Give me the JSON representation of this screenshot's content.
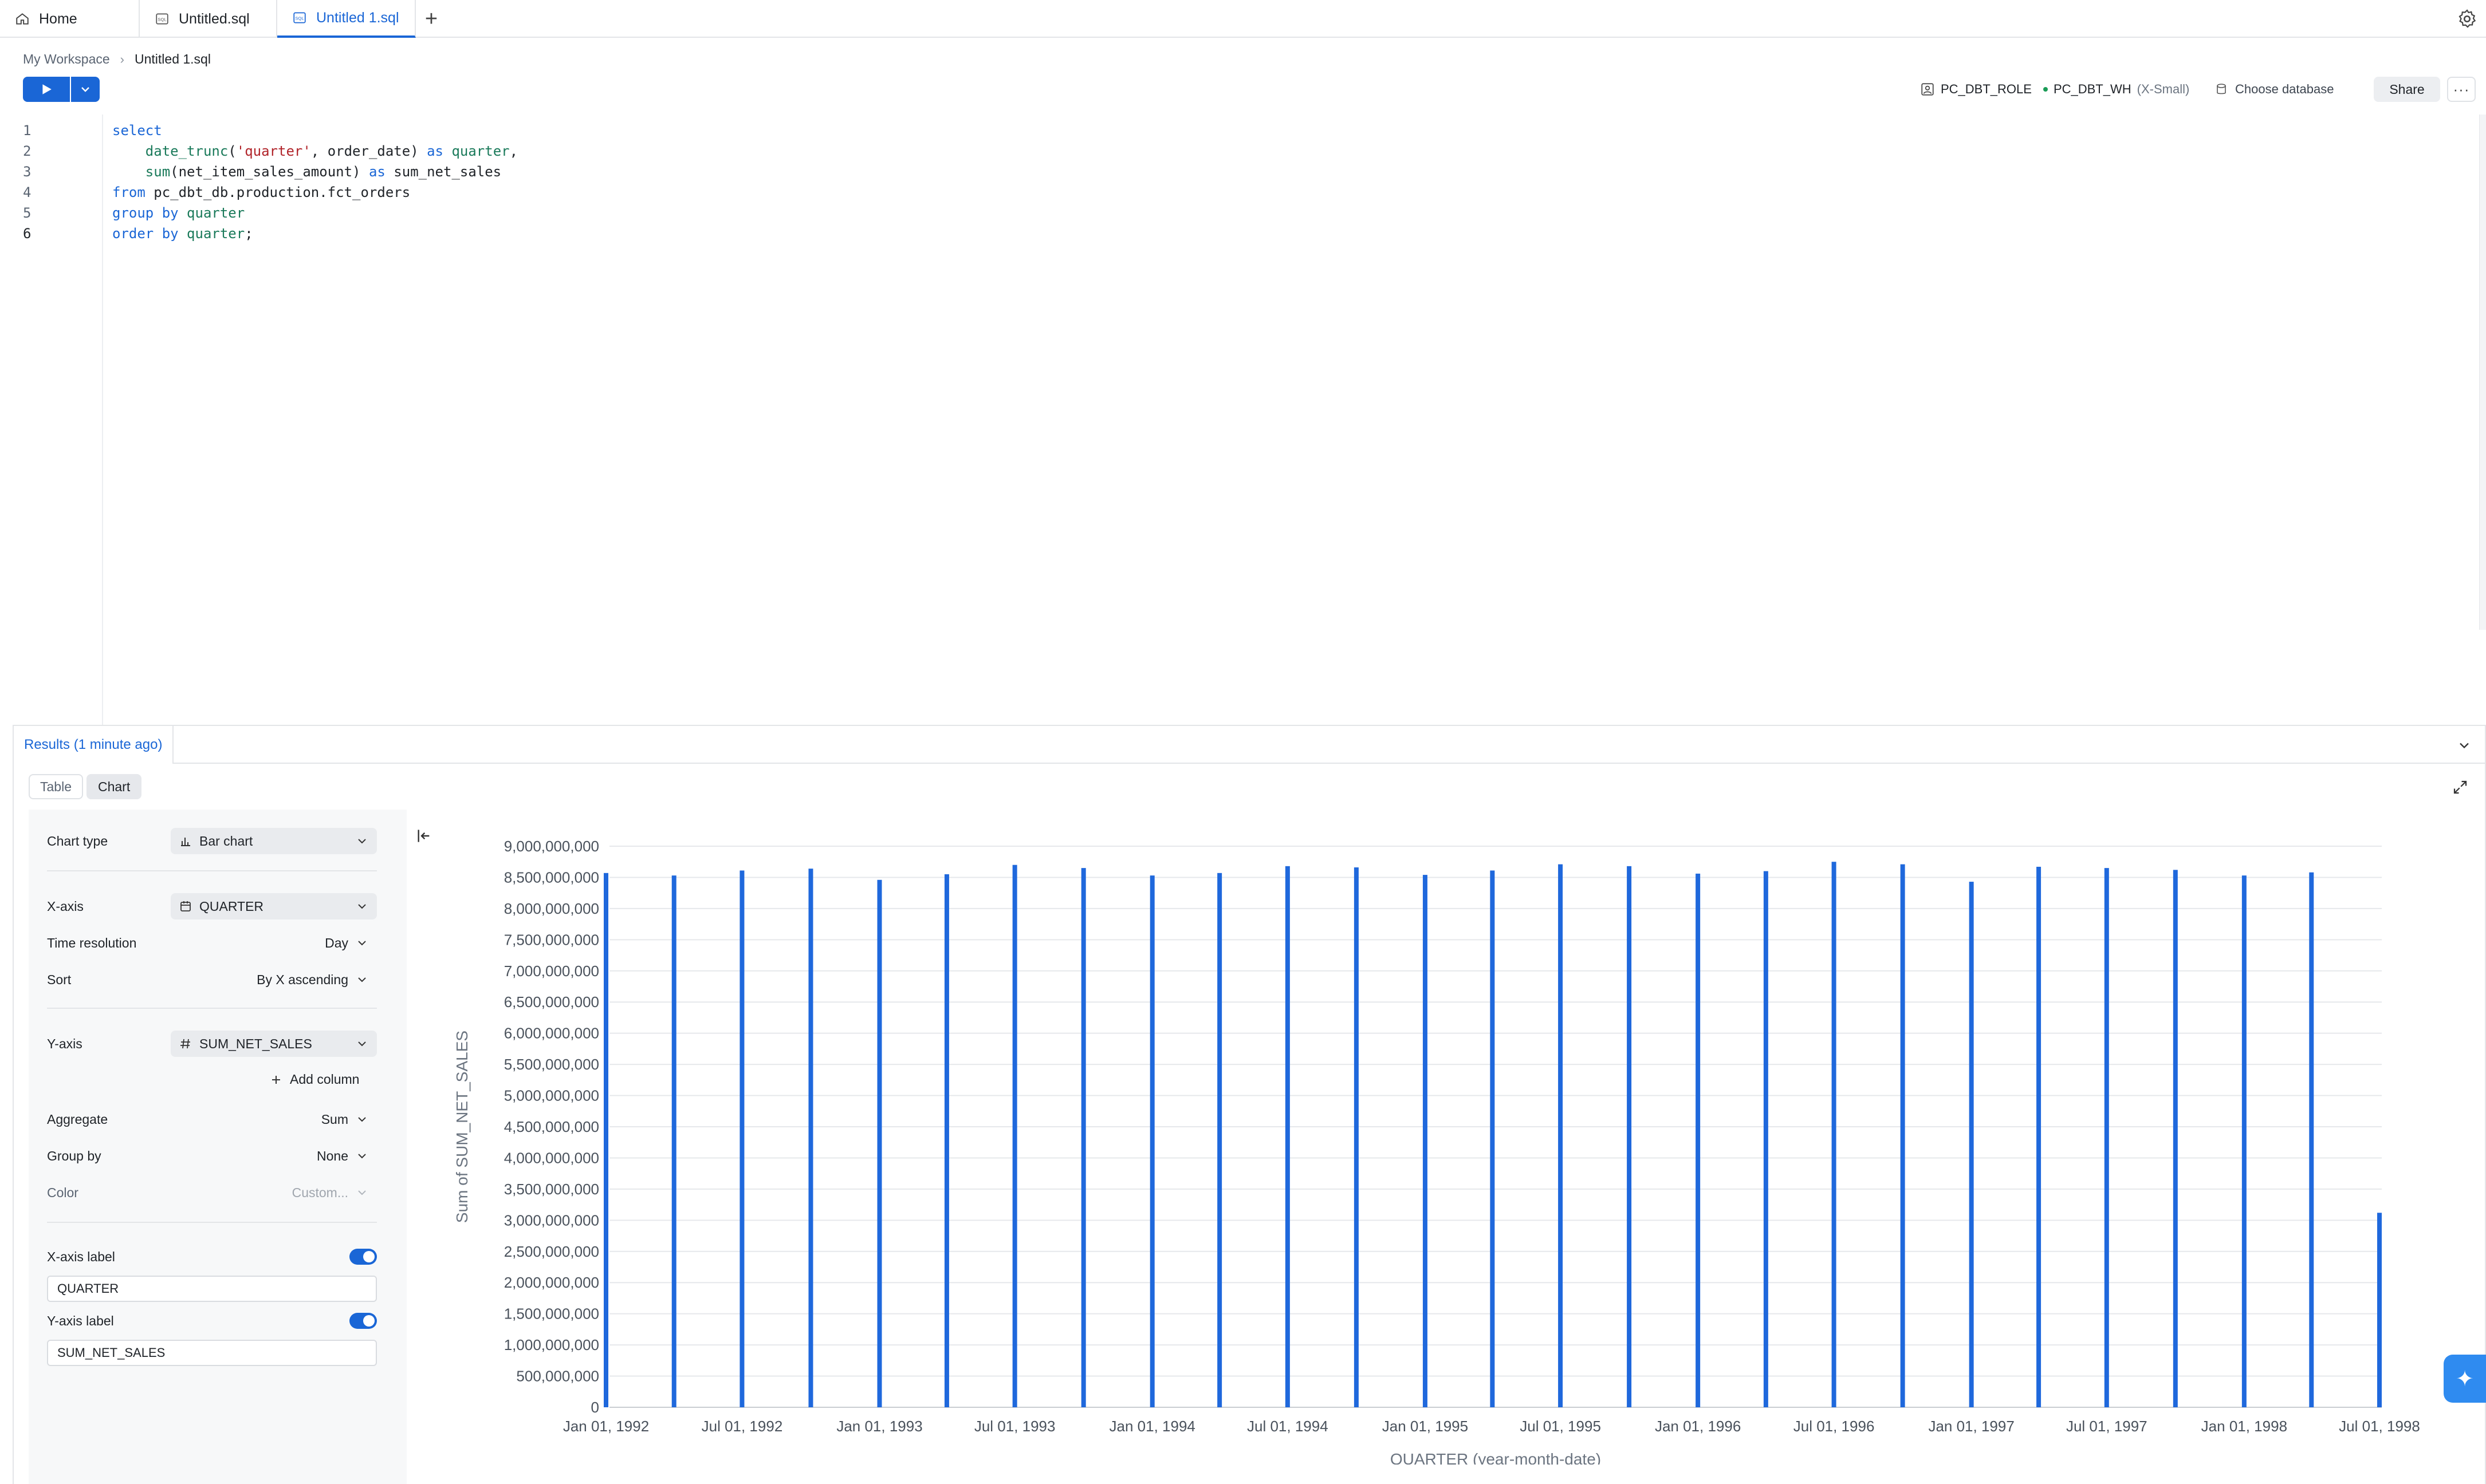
{
  "tabs": [
    {
      "label": "Home",
      "icon": "home-icon"
    },
    {
      "label": "Untitled.sql",
      "icon": "sql-file-icon"
    },
    {
      "label": "Untitled 1.sql",
      "icon": "sql-file-icon",
      "active": true
    }
  ],
  "breadcrumb": {
    "workspace": "My Workspace",
    "current": "Untitled 1.sql"
  },
  "toolbar": {
    "role": "PC_DBT_ROLE",
    "warehouse": "PC_DBT_WH",
    "warehouse_size": "(X-Small)",
    "choose_database": "Choose database",
    "share": "Share",
    "more": "···"
  },
  "editor": {
    "line_numbers": [
      "1",
      "2",
      "3",
      "4",
      "5",
      "6"
    ],
    "lines": [
      [
        {
          "t": "kw",
          "v": "select"
        }
      ],
      [
        {
          "t": "",
          "v": "    "
        },
        {
          "t": "fn",
          "v": "date_trunc"
        },
        {
          "t": "",
          "v": "("
        },
        {
          "t": "str",
          "v": "'quarter'"
        },
        {
          "t": "",
          "v": ", order_date) "
        },
        {
          "t": "kw",
          "v": "as"
        },
        {
          "t": "",
          "v": " "
        },
        {
          "t": "fn",
          "v": "quarter"
        },
        {
          "t": "",
          "v": ","
        }
      ],
      [
        {
          "t": "",
          "v": "    "
        },
        {
          "t": "fn",
          "v": "sum"
        },
        {
          "t": "",
          "v": "(net_item_sales_amount) "
        },
        {
          "t": "kw",
          "v": "as"
        },
        {
          "t": "",
          "v": " sum_net_sales"
        }
      ],
      [
        {
          "t": "kw",
          "v": "from"
        },
        {
          "t": "",
          "v": " pc_dbt_db.production.fct_orders"
        }
      ],
      [
        {
          "t": "kw",
          "v": "group by"
        },
        {
          "t": "",
          "v": " "
        },
        {
          "t": "fn",
          "v": "quarter"
        }
      ],
      [
        {
          "t": "kw",
          "v": "order by"
        },
        {
          "t": "",
          "v": " "
        },
        {
          "t": "fn",
          "v": "quarter"
        },
        {
          "t": "",
          "v": ";"
        }
      ]
    ]
  },
  "results": {
    "tab_label": "Results (1 minute ago)",
    "view_table": "Table",
    "view_chart": "Chart"
  },
  "config": {
    "chart_type_label": "Chart type",
    "chart_type_value": "Bar chart",
    "x_axis_label": "X-axis",
    "x_axis_value": "QUARTER",
    "time_resolution_label": "Time resolution",
    "time_resolution_value": "Day",
    "sort_label": "Sort",
    "sort_value": "By X ascending",
    "y_axis_label": "Y-axis",
    "y_axis_value": "SUM_NET_SALES",
    "add_column": "Add column",
    "aggregate_label": "Aggregate",
    "aggregate_value": "Sum",
    "group_by_label": "Group by",
    "group_by_value": "None",
    "color_label": "Color",
    "color_value": "Custom...",
    "x_label_toggle": "X-axis label",
    "x_label_input": "QUARTER",
    "y_label_toggle": "Y-axis label",
    "y_label_input": "SUM_NET_SALES"
  },
  "colors": {
    "accent": "#1a66d6",
    "bar": "#1f68dc"
  },
  "chart_data": {
    "type": "bar",
    "xlabel": "QUARTER (year-month-date)",
    "ylabel": "Sum of SUM_NET_SALES",
    "ylim": [
      0,
      9000000000
    ],
    "yticks": [
      0,
      500000000,
      1000000000,
      1500000000,
      2000000000,
      2500000000,
      3000000000,
      3500000000,
      4000000000,
      4500000000,
      5000000000,
      5500000000,
      6000000000,
      6500000000,
      7000000000,
      7500000000,
      8000000000,
      8500000000,
      9000000000
    ],
    "ytick_labels": [
      "0",
      "500,000,000",
      "1,000,000,000",
      "1,500,000,000",
      "2,000,000,000",
      "2,500,000,000",
      "3,000,000,000",
      "3,500,000,000",
      "4,000,000,000",
      "4,500,000,000",
      "5,000,000,000",
      "5,500,000,000",
      "6,000,000,000",
      "6,500,000,000",
      "7,000,000,000",
      "7,500,000,000",
      "8,000,000,000",
      "8,500,000,000",
      "9,000,000,000"
    ],
    "xtick_labels": [
      "Jan 01, 1992",
      "Jul 01, 1992",
      "Jan 01, 1993",
      "Jul 01, 1993",
      "Jan 01, 1994",
      "Jul 01, 1994",
      "Jan 01, 1995",
      "Jul 01, 1995",
      "Jan 01, 1996",
      "Jul 01, 1996",
      "Jan 01, 1997",
      "Jul 01, 1997",
      "Jan 01, 1998",
      "Jul 01, 1998"
    ],
    "x": [
      "1992-01-01",
      "1992-04-01",
      "1992-07-01",
      "1992-10-01",
      "1993-01-01",
      "1993-04-01",
      "1993-07-01",
      "1993-10-01",
      "1994-01-01",
      "1994-04-01",
      "1994-07-01",
      "1994-10-01",
      "1995-01-01",
      "1995-04-01",
      "1995-07-01",
      "1995-10-01",
      "1996-01-01",
      "1996-04-01",
      "1996-07-01",
      "1996-10-01",
      "1997-01-01",
      "1997-04-01",
      "1997-07-01",
      "1997-10-01",
      "1998-01-01",
      "1998-04-01",
      "1998-07-01"
    ],
    "values": [
      8570000000,
      8530000000,
      8610000000,
      8640000000,
      8460000000,
      8550000000,
      8700000000,
      8650000000,
      8530000000,
      8570000000,
      8680000000,
      8660000000,
      8540000000,
      8610000000,
      8710000000,
      8680000000,
      8560000000,
      8600000000,
      8750000000,
      8710000000,
      8430000000,
      8670000000,
      8650000000,
      8620000000,
      8530000000,
      8580000000,
      3120000000
    ],
    "grid": true
  }
}
